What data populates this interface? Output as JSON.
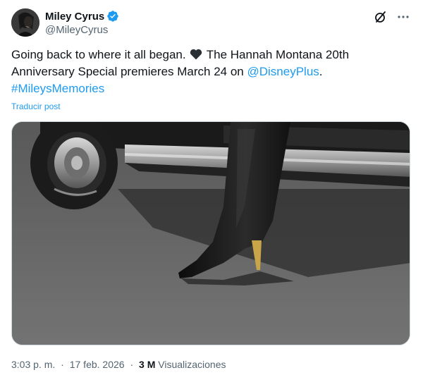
{
  "author": {
    "display_name": "Miley Cyrus",
    "handle": "@MileyCyrus",
    "verified": true
  },
  "tweet": {
    "text_part1": "Going back to where it all began.",
    "text_part2": "The Hannah Montana 20th Anniversary Special premieres March 24 on",
    "mention": "@DisneyPlus",
    "text_part3": ".",
    "hashtag": "#MileysMemories",
    "translate_label": "Traducir post"
  },
  "meta": {
    "time": "3:03 p. m.",
    "separator": "·",
    "date": "17 feb. 2026",
    "views_count": "3 M",
    "views_label": "Visualizaciones"
  },
  "icons": {
    "verified": "verified-badge-icon",
    "grok": "grok-icon",
    "more": "more-options-icon",
    "heart": "black-heart-emoji"
  },
  "colors": {
    "link": "#1d9bf0",
    "text": "#0f1419",
    "secondary": "#536471"
  }
}
